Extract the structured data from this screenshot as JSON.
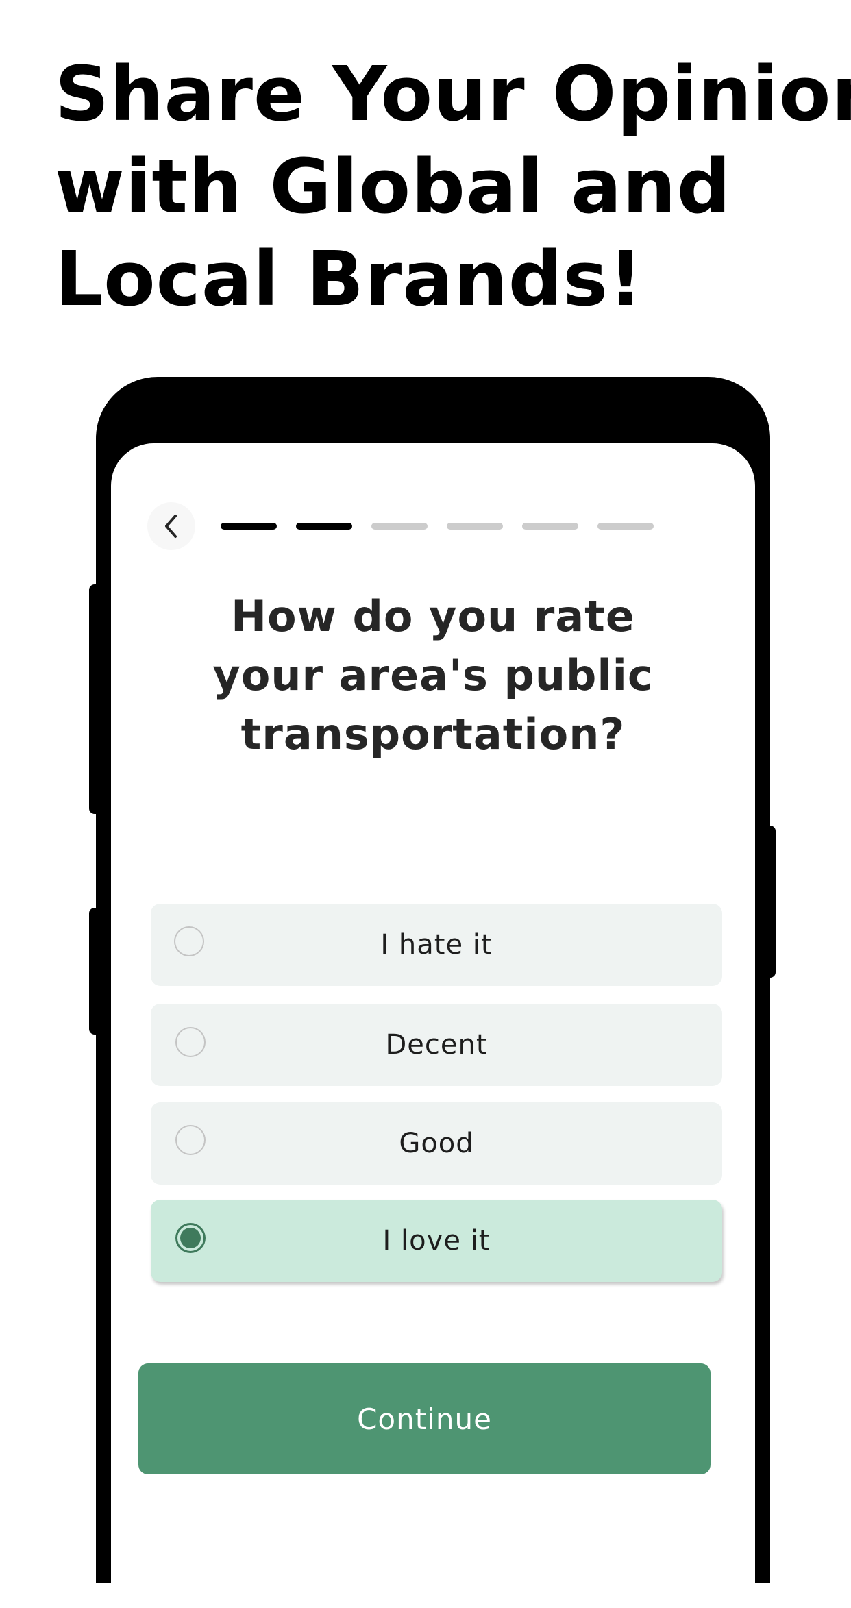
{
  "headline": {
    "lines": [
      "Share Your Opinions",
      "with Global and",
      "Local Brands!"
    ]
  },
  "survey": {
    "back_icon": "chevron-left-icon",
    "progress": {
      "total_steps": 6,
      "completed_steps": 2,
      "active_color": "#000000",
      "inactive_color": "#cccccc"
    },
    "question": {
      "lines": [
        "How do you rate",
        "your area's public",
        "transportation?"
      ]
    },
    "options": [
      {
        "label": "I hate it",
        "selected": false
      },
      {
        "label": "Decent",
        "selected": false
      },
      {
        "label": "Good",
        "selected": false
      },
      {
        "label": "I love it",
        "selected": true
      }
    ],
    "continue_label": "Continue"
  },
  "colors": {
    "accent": "#4e9572",
    "selected_bg": "#cbeadc",
    "option_bg": "#eff3f2",
    "radio_selected": "#3f7a5c"
  }
}
